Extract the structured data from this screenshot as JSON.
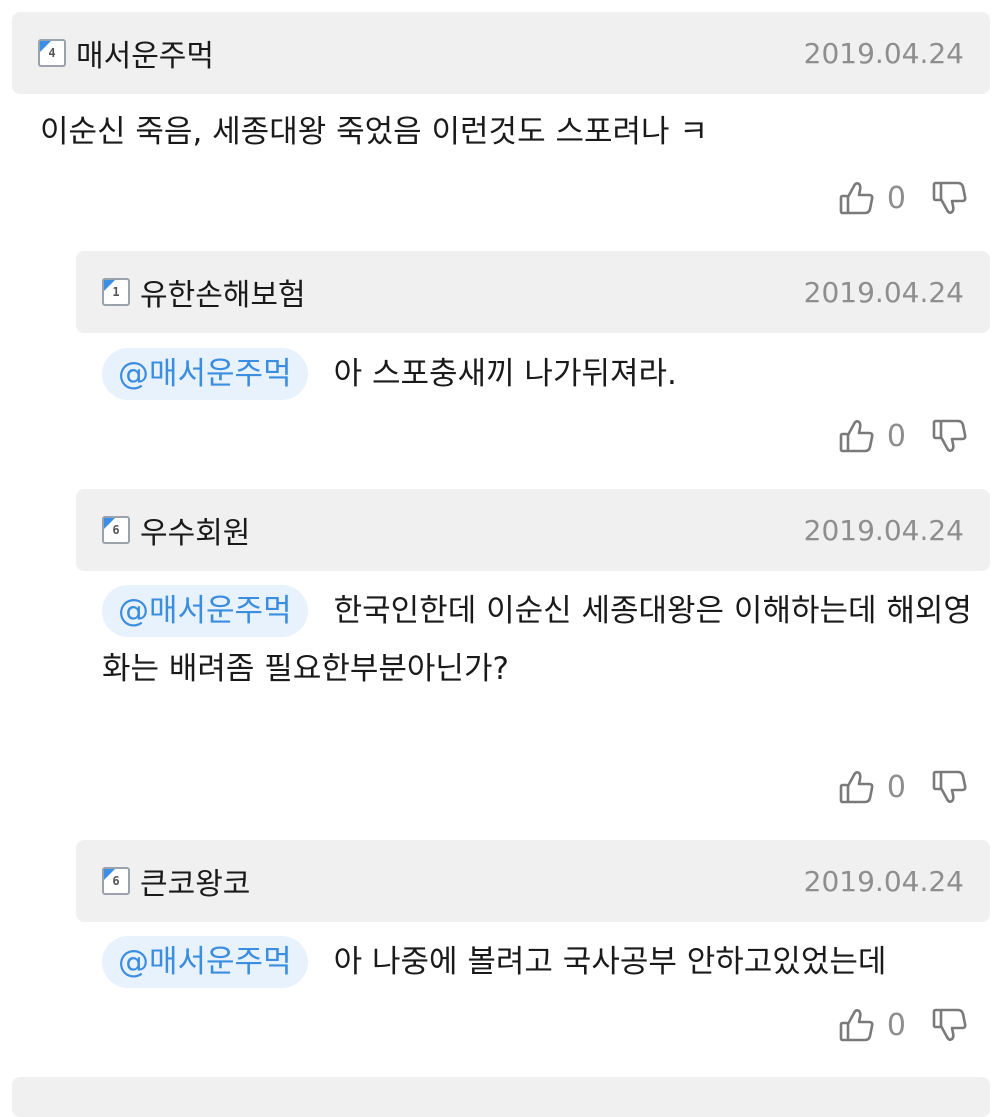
{
  "comments": [
    {
      "level": "4",
      "username": "매서운주먹",
      "date": "2019.04.24",
      "mention": "",
      "text": "이순신 죽음, 세종대왕 죽었음 이런것도 스포려나 ㅋ",
      "likes": "0"
    },
    {
      "level": "1",
      "username": "유한손해보험",
      "date": "2019.04.24",
      "mention": "@매서운주먹",
      "text": "아 스포충새끼 나가뒤져라.",
      "likes": "0"
    },
    {
      "level": "6",
      "username": "우수회원",
      "date": "2019.04.24",
      "mention": "@매서운주먹",
      "text": "한국인한데 이순신 세종대왕은 이해하는데 해외영화는 배려좀 필요한부분아닌가?",
      "likes": "0"
    },
    {
      "level": "6",
      "username": "큰코왕코",
      "date": "2019.04.24",
      "mention": "@매서운주먹",
      "text": "아 나중에 볼려고 국사공부 안하고있었는데",
      "likes": "0"
    }
  ],
  "icons": {
    "like": "thumbs-up-icon",
    "dislike": "thumbs-down-icon",
    "level": "level-badge-icon"
  },
  "colors": {
    "header_bg": "#f0f0f0",
    "mention_bg": "#e8f2fd",
    "mention_text": "#3b8de0",
    "muted": "#8e8e8e"
  }
}
